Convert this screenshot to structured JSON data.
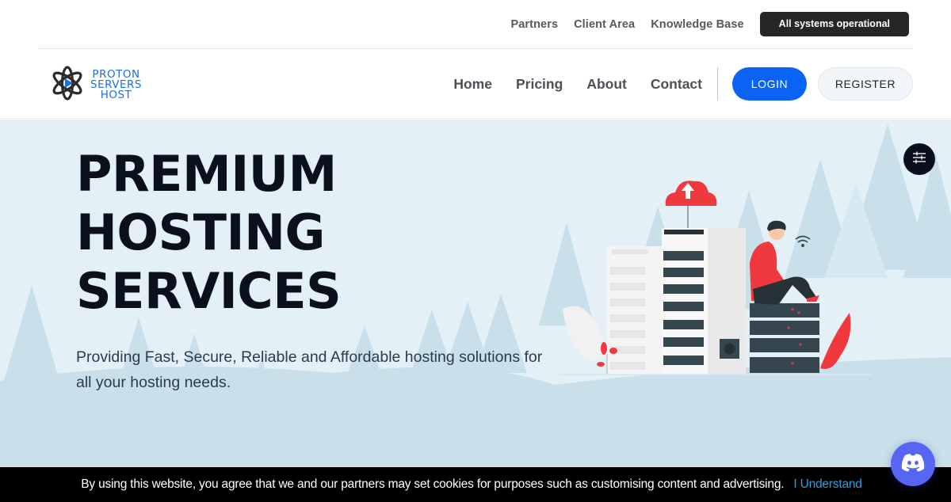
{
  "topbar": {
    "links": [
      "Partners",
      "Client Area",
      "Knowledge Base"
    ],
    "status": "All systems operational"
  },
  "brand": {
    "logo_lines": [
      "PROTON",
      "SERVERS",
      "HOST"
    ],
    "logo_icon": "atom-play-icon"
  },
  "nav": {
    "links": [
      "Home",
      "Pricing",
      "About",
      "Contact"
    ],
    "login_label": "LOGIN",
    "register_label": "REGISTER"
  },
  "hero": {
    "title_lines": [
      "PREMIUM",
      "HOSTING",
      "SERVICES"
    ],
    "subtitle": "Providing Fast, Secure, Reliable and Affordable hosting solutions for all your hosting needs.",
    "illustration": "server-racks-with-person-and-cloud-upload"
  },
  "settings_button": {
    "icon": "sliders-icon"
  },
  "cookie": {
    "text": "By using this website, you agree that we and our partners may set cookies for purposes such as customising content and advertising.",
    "accept_label": "I Understand"
  },
  "discord": {
    "icon": "discord-icon"
  },
  "colors": {
    "accent": "#0a63f5",
    "brand_blue": "#1f6fe0",
    "hero_bg": "#e3f1f7",
    "dark": "#0c0f1c",
    "illustration_red": "#f0393f",
    "discord": "#5865f2",
    "cookie_link": "#2e9ede"
  }
}
